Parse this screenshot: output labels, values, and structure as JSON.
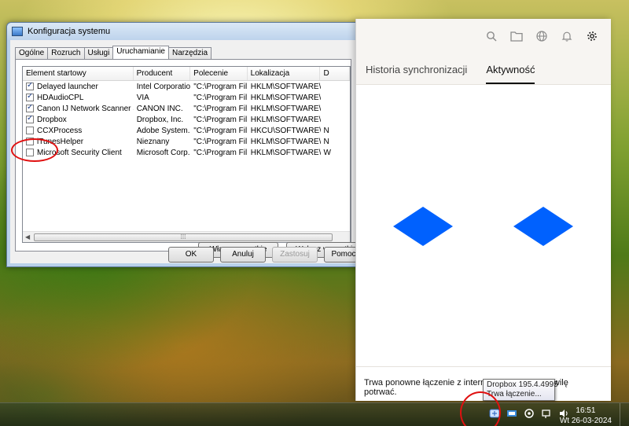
{
  "window": {
    "title": "Konfiguracja systemu",
    "tabs": [
      "Ogólne",
      "Rozruch",
      "Usługi",
      "Uruchamianie",
      "Narzędzia"
    ],
    "columns": [
      "Element startowy",
      "Producent",
      "Polecenie",
      "Lokalizacja",
      "D"
    ],
    "rows": [
      {
        "name": "Delayed launcher",
        "maker": "Intel Corporation",
        "cmd": "\"C:\\Program Fil...",
        "loc": "HKLM\\SOFTWARE\\M...",
        "d": ""
      },
      {
        "name": "HDAudioCPL",
        "maker": "VIA",
        "cmd": "\"C:\\Program Fil...",
        "loc": "HKLM\\SOFTWARE\\M...",
        "d": ""
      },
      {
        "name": "Canon IJ Network Scanner Sele...",
        "maker": "CANON INC.",
        "cmd": "\"C:\\Program Fil...",
        "loc": "HKLM\\SOFTWARE\\M...",
        "d": ""
      },
      {
        "name": "Dropbox",
        "maker": "Dropbox, Inc.",
        "cmd": "\"C:\\Program Fil...",
        "loc": "HKLM\\SOFTWARE\\M...",
        "d": ""
      },
      {
        "name": "CCXProcess",
        "maker": "Adobe System...",
        "cmd": "\"C:\\Program Fil...",
        "loc": "HKCU\\SOFTWARE\\...",
        "d": "N"
      },
      {
        "name": "iTunesHelper",
        "maker": "Nieznany",
        "cmd": "\"C:\\Program Fil...",
        "loc": "HKLM\\SOFTWARE\\M...",
        "d": "N"
      },
      {
        "name": "Microsoft Security Client",
        "maker": "Microsoft Corp...",
        "cmd": "\"C:\\Program Fil...",
        "loc": "HKLM\\SOFTWARE\\M...",
        "d": "W"
      }
    ],
    "enable_all": "Włącz wszystkie",
    "disable_all": "Wyłącz wszystkie",
    "ok": "OK",
    "cancel": "Anuluj",
    "apply": "Zastosuj",
    "help": "Pomoc"
  },
  "dropbox": {
    "tabs": [
      "Historia synchronizacji",
      "Aktywność"
    ],
    "status": "Trwa ponowne łączenie z internetem. To może chwilę potrwać.",
    "logo_color": "#0061fe"
  },
  "tooltip": {
    "line1": "Dropbox 195.4.4995",
    "line2": "Trwa łączenie..."
  },
  "taskbar": {
    "time": "16:51",
    "date": "Wt 26-03-2024"
  }
}
